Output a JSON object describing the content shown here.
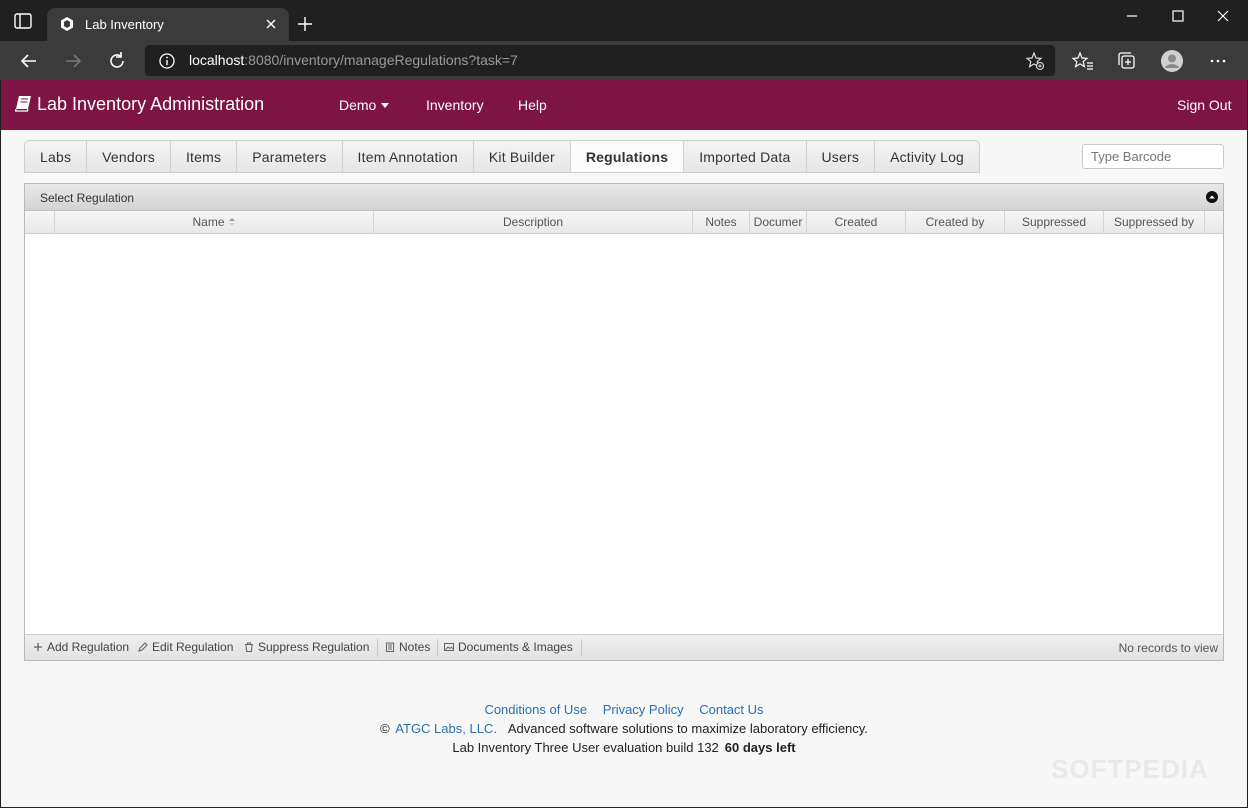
{
  "browser": {
    "tab_title": "Lab Inventory",
    "url_host": "localhost",
    "url_path": ":8080/inventory/manageRegulations?task=7"
  },
  "nav": {
    "brand": "Lab Inventory Administration",
    "demo": "Demo",
    "inventory": "Inventory",
    "help": "Help",
    "sign_out": "Sign Out"
  },
  "tabs": [
    {
      "label": "Labs",
      "active": false
    },
    {
      "label": "Vendors",
      "active": false
    },
    {
      "label": "Items",
      "active": false
    },
    {
      "label": "Parameters",
      "active": false
    },
    {
      "label": "Item Annotation",
      "active": false
    },
    {
      "label": "Kit Builder",
      "active": false
    },
    {
      "label": "Regulations",
      "active": true
    },
    {
      "label": "Imported Data",
      "active": false
    },
    {
      "label": "Users",
      "active": false
    },
    {
      "label": "Activity Log",
      "active": false
    }
  ],
  "barcode_placeholder": "Type Barcode",
  "grid": {
    "caption": "Select Regulation",
    "columns": [
      "",
      "Name",
      "Description",
      "Notes",
      "Documer",
      "Created",
      "Created by",
      "Suppressed",
      "Suppressed by"
    ],
    "rows": [],
    "pager": {
      "add": "Add Regulation",
      "edit": "Edit Regulation",
      "suppress": "Suppress Regulation",
      "notes": "Notes",
      "documents": "Documents & Images",
      "records": "No records to view"
    }
  },
  "footer": {
    "conditions": "Conditions of Use",
    "privacy": "Privacy Policy",
    "contact": "Contact Us",
    "copyright": "©",
    "company": "ATGC Labs, LLC.",
    "tagline": "Advanced software solutions to maximize laboratory efficiency.",
    "build": "Lab Inventory Three User evaluation build 132",
    "days_left": "60 days left"
  },
  "watermark": "SOFTPEDIA",
  "colors": {
    "navbar": "#7d1443",
    "link": "#2a6fb0"
  }
}
